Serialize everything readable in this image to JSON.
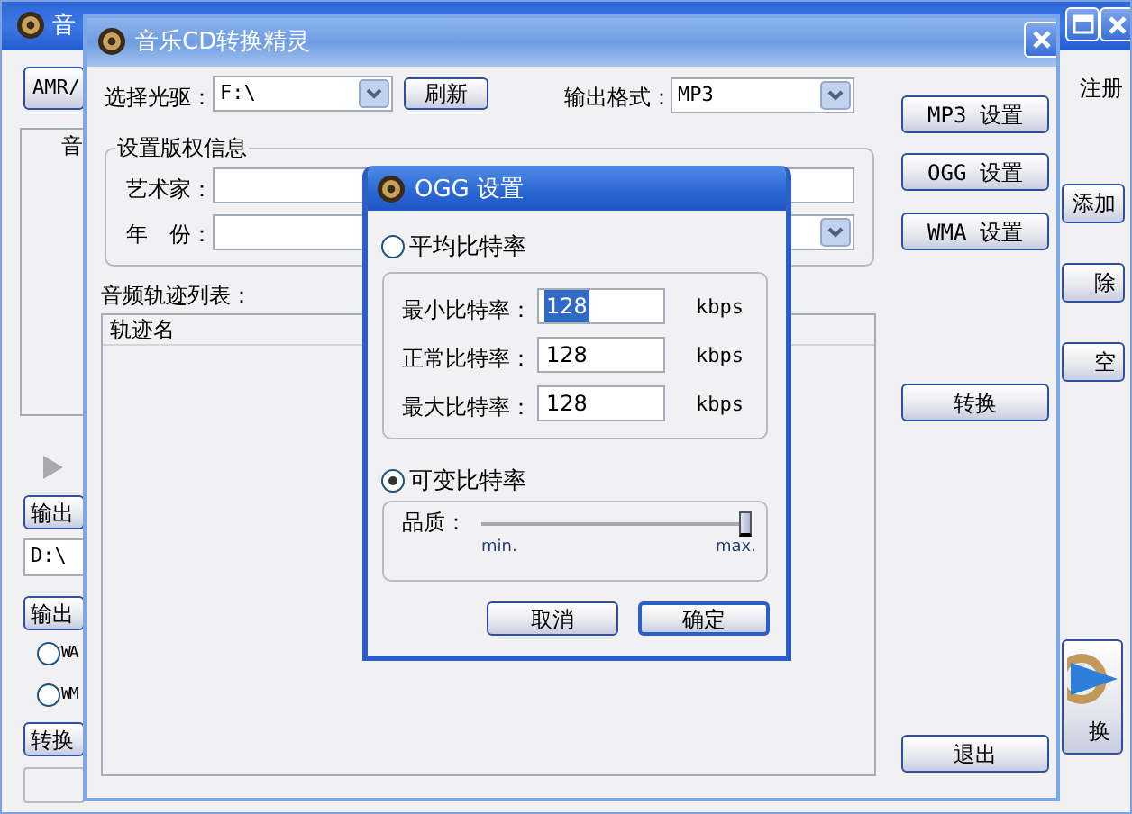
{
  "back_window": {
    "title": "音",
    "top_button": "AMR/",
    "list_header": "音",
    "output_path_button": "输出",
    "output_path": "D:\\",
    "output_format_button": "输出",
    "format_options": [
      {
        "label": "WA",
        "selected": false
      },
      {
        "label": "WM",
        "selected": false
      }
    ],
    "progress_button": "转换",
    "register_label": "注册",
    "side_buttons": [
      "添加",
      "除",
      "空"
    ],
    "big_button": "换"
  },
  "cd_window": {
    "title": "音乐CD转换精灵",
    "drive_label": "选择光驱：",
    "drive_value": "F:\\",
    "refresh_button": "刷新",
    "format_label": "输出格式：",
    "format_value": "MP3",
    "copyright_group": "设置版权信息",
    "artist_label": "艺术家：",
    "year_label": "年　份：",
    "track_list_label": "音频轨迹列表：",
    "track_column": "轨迹名",
    "buttons": [
      "MP3 设置",
      "OGG 设置",
      "WMA 设置",
      "转换",
      "退出"
    ]
  },
  "ogg_dialog": {
    "title": "OGG 设置",
    "modes": [
      {
        "kind": "bitrate",
        "label": "平均比特率",
        "selected": false,
        "rows": [
          {
            "label": "最小比特率：",
            "value": "128",
            "unit": "kbps",
            "selected": true
          },
          {
            "label": "正常比特率：",
            "value": "128",
            "unit": "kbps",
            "selected": false
          },
          {
            "label": "最大比特率：",
            "value": "128",
            "unit": "kbps",
            "selected": false
          }
        ]
      },
      {
        "kind": "quality",
        "label": "可变比特率",
        "selected": true,
        "quality_label": "品质：",
        "level": 1,
        "min_label": "min.",
        "max_label": "max."
      }
    ],
    "buttons": [
      {
        "label": "取消",
        "default": false
      },
      {
        "label": "确定",
        "default": true
      }
    ]
  }
}
